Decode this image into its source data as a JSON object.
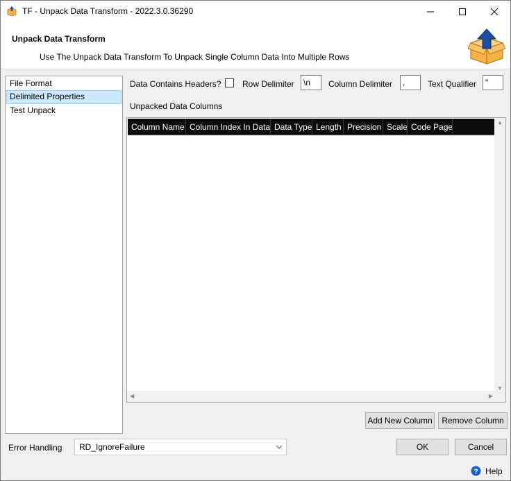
{
  "window": {
    "title": "TF - Unpack Data Transform - 2022.3.0.36290"
  },
  "header": {
    "title": "Unpack Data Transform",
    "description": "Use The Unpack Data Transform To Unpack Single Column Data Into Multiple Rows",
    "logo_icon": "box-upload-icon"
  },
  "nav": {
    "items": [
      {
        "label": "File Format"
      },
      {
        "label": "Delimited Properties",
        "selected": true
      },
      {
        "label": "Test Unpack"
      }
    ]
  },
  "options": {
    "headers_label": "Data Contains Headers?",
    "headers_checked": false,
    "row_delimiter_label": "Row Delimiter",
    "row_delimiter_value": "\\n",
    "column_delimiter_label": "Column Delimiter",
    "column_delimiter_value": ",",
    "text_qualifier_label": "Text Qualifier",
    "text_qualifier_value": "\""
  },
  "grid": {
    "title": "Unpacked Data Columns",
    "columns": [
      "Column Name",
      "Column Index In Data",
      "Data Type",
      "Length",
      "Precision",
      "Scale",
      "Code Page"
    ],
    "rows": []
  },
  "buttons": {
    "add_column": "Add New Column",
    "remove_column": "Remove Column",
    "ok": "OK",
    "cancel": "Cancel"
  },
  "error_handling": {
    "label": "Error Handling",
    "value": "RD_IgnoreFailure"
  },
  "status": {
    "help": "Help"
  },
  "colors": {
    "selection_bg": "#cce8ff",
    "grid_header_bg": "#0c0c0c",
    "box_orange": "#f5b347",
    "arrow_blue": "#1f4e9e"
  }
}
